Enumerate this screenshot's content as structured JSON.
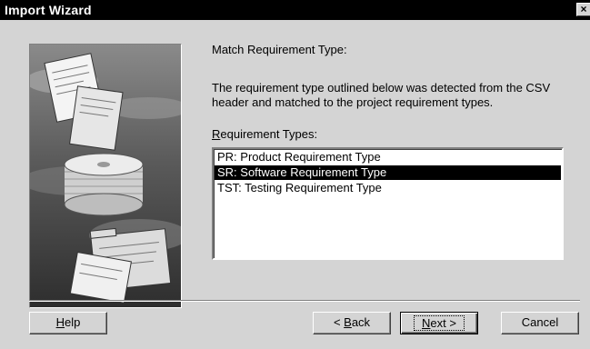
{
  "window": {
    "title": "Import Wizard",
    "close_glyph": "×"
  },
  "content": {
    "heading": "Match Requirement Type:",
    "description": "The requirement type outlined below was detected from the CSV header and matched to the project requirement types.",
    "list_label_accel": "R",
    "list_label_rest": "equirement Types:"
  },
  "requirement_types": [
    {
      "label": "PR: Product Requirement Type",
      "selected": false
    },
    {
      "label": "SR: Software Requirement Type",
      "selected": true
    },
    {
      "label": "TST: Testing Requirement Type",
      "selected": false
    }
  ],
  "buttons": {
    "help_accel": "H",
    "help_rest": "elp",
    "back_prefix": "< ",
    "back_accel": "B",
    "back_rest": "ack",
    "next_accel": "N",
    "next_rest": "ext >",
    "cancel": "Cancel"
  },
  "illustration": {
    "subject": "documents, disk stack and folders over sky"
  }
}
